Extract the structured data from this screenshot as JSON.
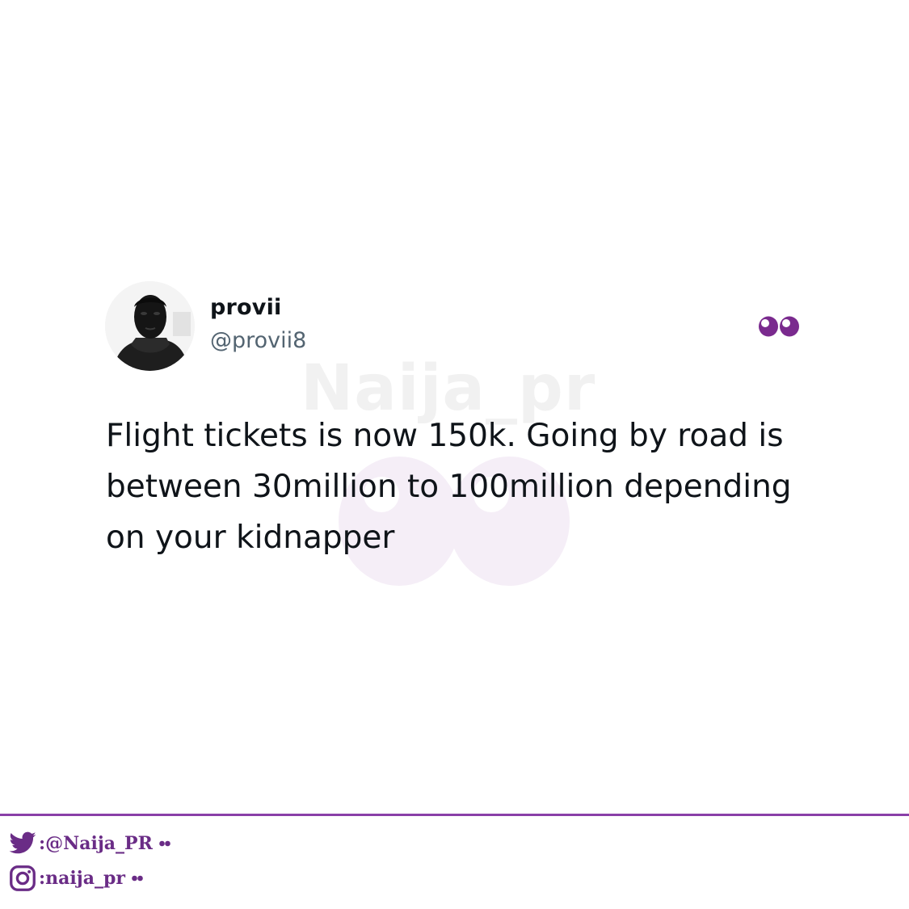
{
  "watermark": {
    "text": "Naija_pr"
  },
  "tweet": {
    "display_name": "provii",
    "handle": "@provii8",
    "emoji_icon": "eyes-icon",
    "text": "Flight tickets is now 150k. Going by road is between 30million to 100million depending on your kidnapper"
  },
  "footer": {
    "twitter": {
      "icon": "twitter-bird-icon",
      "label": ":@Naija_PR"
    },
    "instagram": {
      "icon": "instagram-icon",
      "label": ":naija_pr"
    }
  },
  "colors": {
    "accent_purple": "#6a2c86",
    "divider_purple": "#8a3fa8",
    "text_primary": "#0f1419",
    "text_secondary": "#536471"
  }
}
